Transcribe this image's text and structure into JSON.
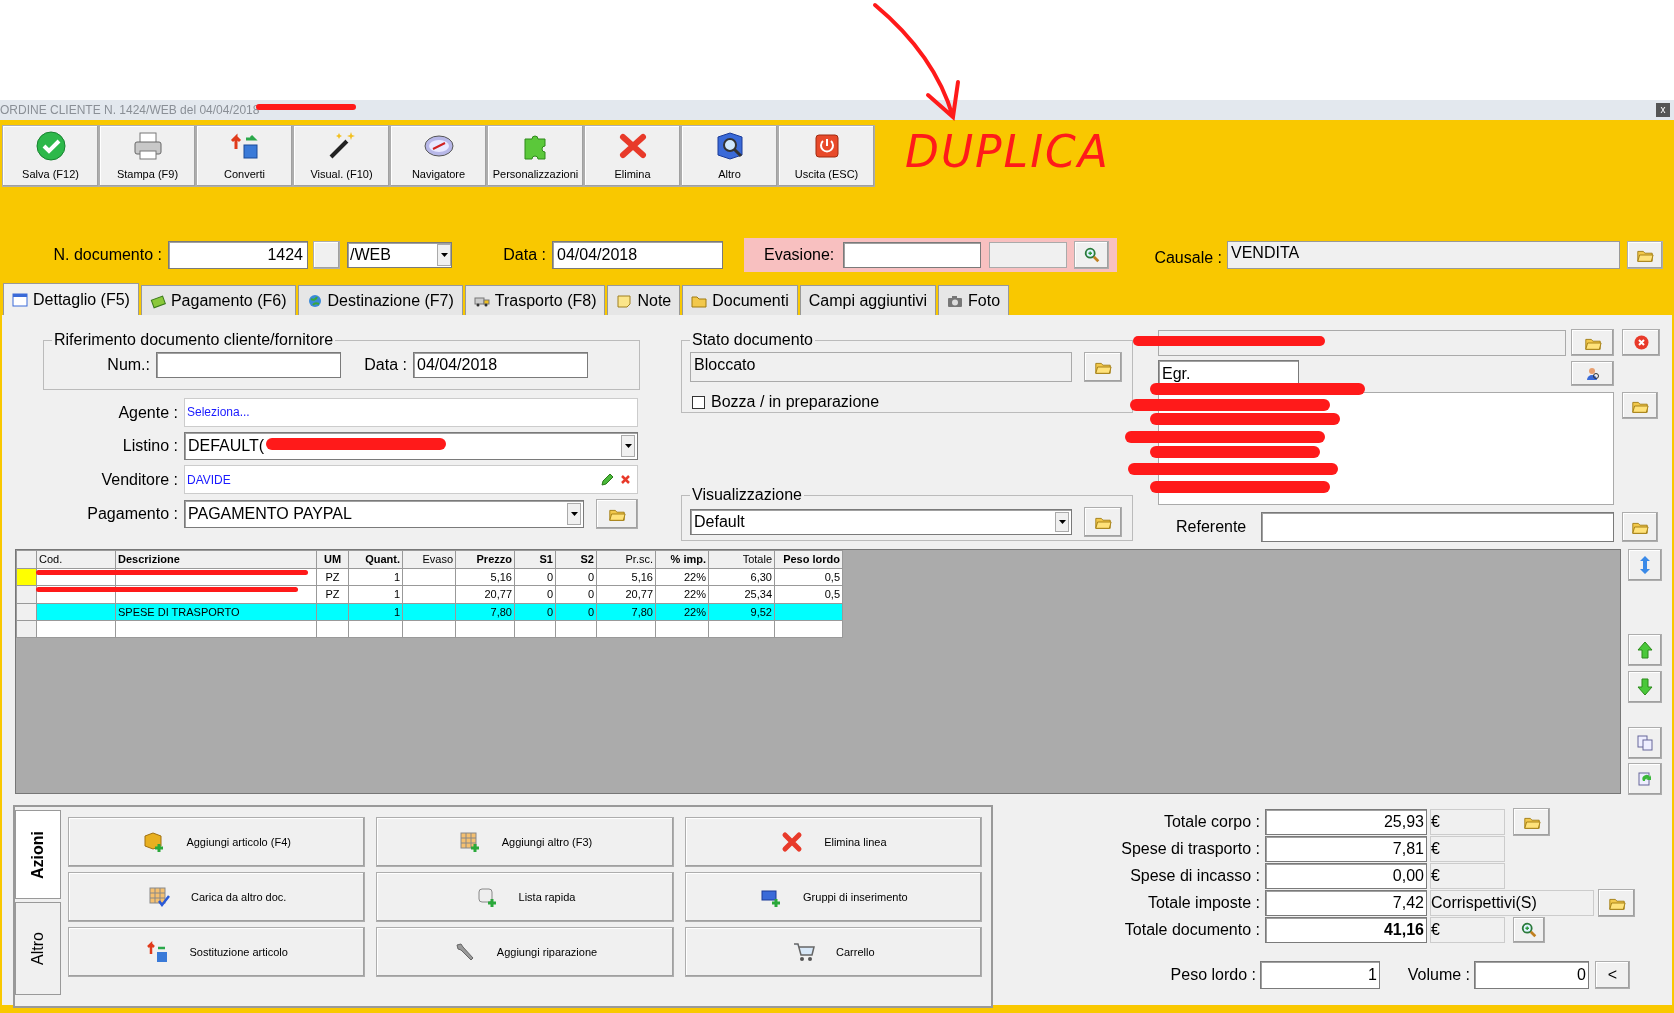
{
  "annotation": {
    "text": "DUPLICA"
  },
  "window": {
    "title": "ORDINE CLIENTE N. 1424/WEB del 04/04/2018",
    "close": "x"
  },
  "toolbar": [
    "Salva (F12)",
    "Stampa (F9)",
    "Converti",
    "Visual. (F10)",
    "Navigatore",
    "Personalizzazioni",
    "Elimina",
    "Altro",
    "Uscita (ESC)"
  ],
  "header": {
    "numero_label": "N. documento :",
    "numero": "1424",
    "serie": "/WEB",
    "data_label": "Data :",
    "data": "04/04/2018",
    "evasione_label": "Evasione:",
    "causale_label": "Causale :",
    "causale": "VENDITA"
  },
  "tabs": [
    {
      "label": "Dettaglio (F5)",
      "selected": true
    },
    {
      "label": "Pagamento (F6)",
      "selected": false
    },
    {
      "label": "Destinazione (F7)",
      "selected": false
    },
    {
      "label": "Trasporto (F8)",
      "selected": false
    },
    {
      "label": "Note",
      "selected": false
    },
    {
      "label": "Documenti",
      "selected": false
    },
    {
      "label": "Campi aggiuntivi",
      "selected": false
    },
    {
      "label": "Foto",
      "selected": false
    }
  ],
  "riferimento": {
    "title": "Riferimento documento cliente/fornitore",
    "num_label": "Num.:",
    "data_label": "Data :",
    "data": "04/04/2018"
  },
  "fields": [
    {
      "label": "Agente :",
      "value": "Seleziona...",
      "kind": "link"
    },
    {
      "label": "Listino :",
      "value": "DEFAULT(",
      "kind": "combo"
    },
    {
      "label": "Venditore :",
      "value": "DAVIDE",
      "kind": "edit"
    },
    {
      "label": "Pagamento :",
      "value": "PAGAMENTO PAYPAL",
      "kind": "combo-folder"
    }
  ],
  "stato": {
    "title": "Stato documento",
    "value": "Bloccato",
    "checkbox": {
      "label": "Bozza / in preparazione",
      "checked": false
    }
  },
  "visualizzazione": {
    "title": "Visualizzazione",
    "value": "Default"
  },
  "cliente": {
    "salutation": "Egr.",
    "referente_label": "Referente"
  },
  "table": {
    "columns": [
      {
        "label": "Cod.",
        "bold": false
      },
      {
        "label": "Descrizione",
        "bold": true
      },
      {
        "label": "UM",
        "bold": true
      },
      {
        "label": "Quant.",
        "bold": true
      },
      {
        "label": "Evaso",
        "bold": false
      },
      {
        "label": "Prezzo",
        "bold": true
      },
      {
        "label": "S1",
        "bold": true
      },
      {
        "label": "S2",
        "bold": true
      },
      {
        "label": "Pr.sc.",
        "bold": false
      },
      {
        "label": "% imp.",
        "bold": true
      },
      {
        "label": "Totale",
        "bold": false
      },
      {
        "label": "Peso lordo",
        "bold": true
      }
    ],
    "rows": [
      {
        "selected": true,
        "highlighted": false,
        "cells": [
          null,
          null,
          "PZ",
          "1",
          null,
          "5,16",
          "0",
          "0",
          "5,16",
          "22%",
          "6,30",
          "0,5"
        ]
      },
      {
        "selected": false,
        "highlighted": false,
        "cells": [
          null,
          null,
          "PZ",
          "1",
          null,
          "20,77",
          "0",
          "0",
          "20,77",
          "22%",
          "25,34",
          "0,5"
        ]
      },
      {
        "selected": false,
        "highlighted": true,
        "cells": [
          null,
          "SPESE DI TRASPORTO",
          null,
          "1",
          null,
          "7,80",
          "0",
          "0",
          "7,80",
          "22%",
          "9,52",
          null
        ]
      }
    ]
  },
  "actions": {
    "tabs": [
      {
        "label": "Azioni",
        "selected": true
      },
      {
        "label": "Altro",
        "selected": false
      }
    ],
    "buttons": [
      "Aggiungi articolo (F4)",
      "Aggiungi altro (F3)",
      "Elimina linea",
      "Carica da altro doc.",
      "Lista rapida",
      "Gruppi di inserimento",
      "Sostituzione articolo",
      "Aggiungi riparazione",
      "Carrello"
    ]
  },
  "totals": [
    {
      "label": "Totale corpo :",
      "value": "25,93",
      "unit": "€",
      "kind": "folder"
    },
    {
      "label": "Spese di trasporto :",
      "value": "7,81",
      "unit": "€",
      "kind": "plain"
    },
    {
      "label": "Spese di incasso :",
      "value": "0,00",
      "unit": "€",
      "kind": "plain"
    },
    {
      "label": "Totale imposte :",
      "value": "7,42",
      "unit": "Corrispettivi(S)",
      "kind": "tax"
    },
    {
      "label": "Totale documento :",
      "value": "41,16",
      "unit": "€",
      "kind": "grand"
    }
  ],
  "peso": {
    "label": "Peso lordo :",
    "value": "1"
  },
  "volume": {
    "label": "Volume :",
    "value": "0"
  },
  "collapse_button": "<"
}
